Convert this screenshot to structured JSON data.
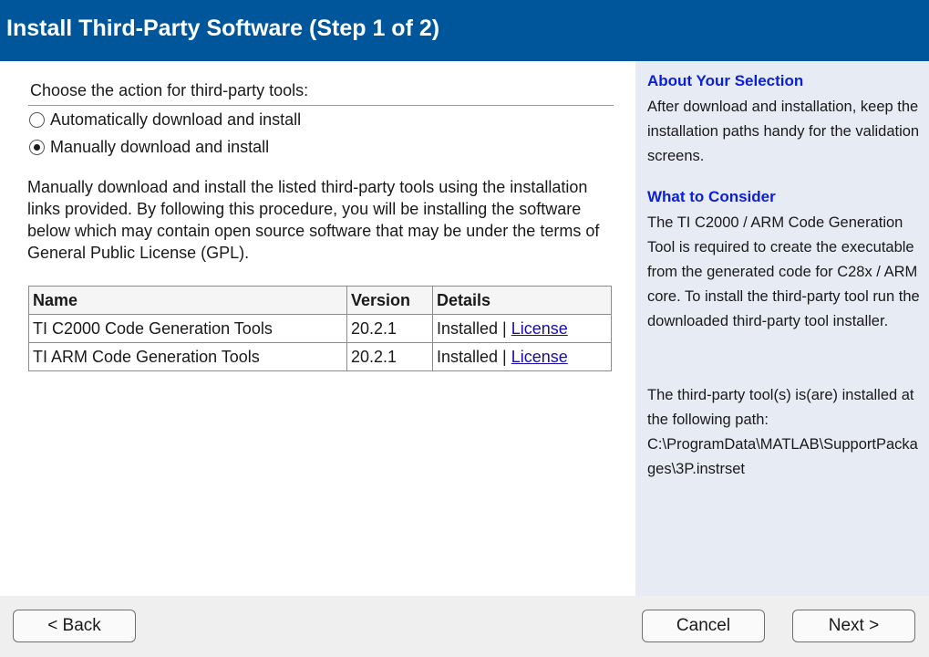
{
  "header": {
    "title": "Install Third-Party Software (Step 1 of 2)"
  },
  "main": {
    "section_label": "Choose the action for third-party tools:",
    "radio_options": [
      {
        "label": "Automatically download and install",
        "selected": false
      },
      {
        "label": "Manually download and install",
        "selected": true
      }
    ],
    "description": "Manually download and install the listed third-party tools using the installation links provided. By following this procedure, you will be installing the software below which may contain open source software that may be under the terms of General Public License (GPL).",
    "table": {
      "headers": [
        "Name",
        "Version",
        "Details"
      ],
      "rows": [
        {
          "name": "TI C2000 Code Generation Tools",
          "version": "20.2.1",
          "status": "Installed",
          "separator": " | ",
          "link": "License"
        },
        {
          "name": "TI ARM Code Generation Tools",
          "version": "20.2.1",
          "status": "Installed",
          "separator": " | ",
          "link": "License"
        }
      ]
    }
  },
  "sidebar": {
    "about_heading": "About Your Selection",
    "about_text": "After download and installation, keep the installation paths handy for the validation screens.",
    "consider_heading": "What to Consider",
    "consider_text": "The TI C2000 / ARM Code Generation Tool is required to create the executable from the generated code for C28x / ARM core. To install the third-party tool run the downloaded third-party tool installer.",
    "path_intro": "The third-party tool(s) is(are) installed at the following path:",
    "path": "C:\\ProgramData\\MATLAB\\SupportPackages\\3P.instrset"
  },
  "footer": {
    "back_label": "< Back",
    "cancel_label": "Cancel",
    "next_label": "Next >"
  },
  "colors": {
    "header_bg": "#00569b",
    "sidebar_bg": "#e7ebf3",
    "sidebar_heading": "#0b1fd9",
    "link": "#1a0dab",
    "footer_bg": "#efefef"
  }
}
